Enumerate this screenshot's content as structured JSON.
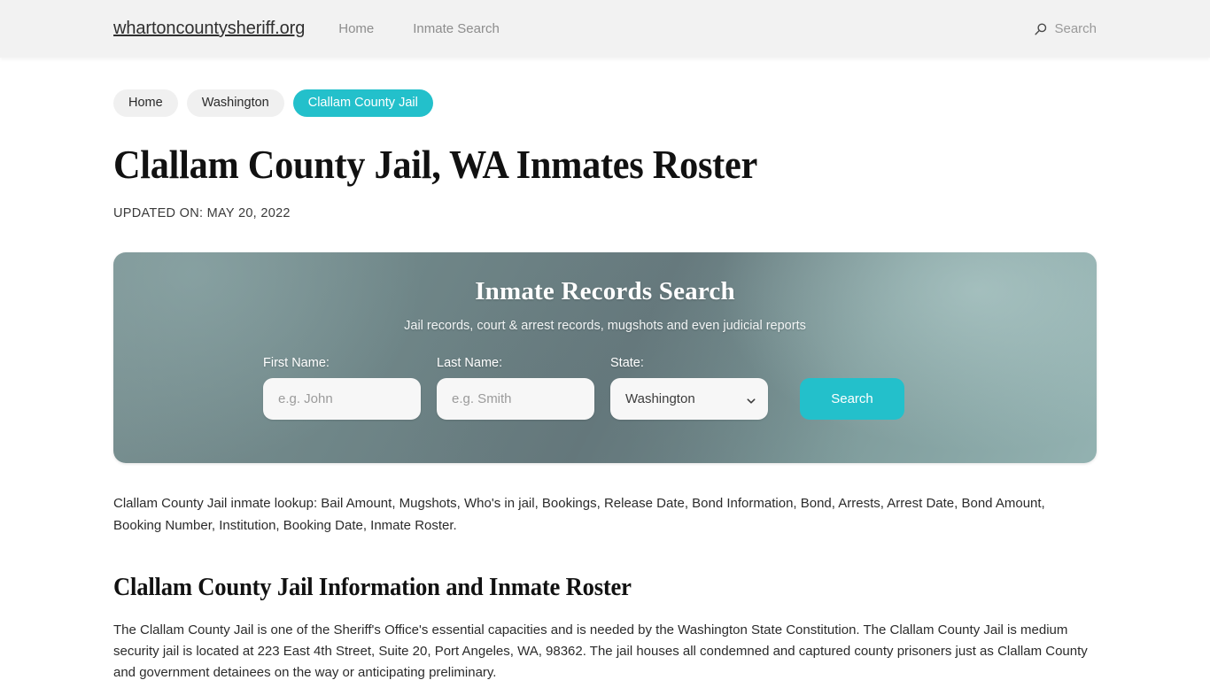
{
  "header": {
    "brand": "whartoncountysheriff.org",
    "nav": [
      {
        "label": "Home"
      },
      {
        "label": "Inmate Search"
      }
    ],
    "search": {
      "icon": "search-icon",
      "label": "Search"
    }
  },
  "breadcrumb": [
    {
      "label": "Home",
      "active": false
    },
    {
      "label": "Washington",
      "active": false
    },
    {
      "label": "Clallam County Jail",
      "active": true
    }
  ],
  "main": {
    "title": "Clallam County Jail, WA Inmates Roster",
    "updated": "UPDATED ON: MAY 20, 2022",
    "lookup_text": "Clallam County Jail inmate lookup: Bail Amount, Mugshots, Who's in jail, Bookings, Release Date, Bond Information, Bond, Arrests, Arrest Date, Bond Amount, Booking Number, Institution, Booking Date, Inmate Roster.",
    "section_title": "Clallam County Jail Information and Inmate Roster",
    "body_text": "The Clallam County Jail is one of the Sheriff's Office's essential capacities and is needed by the Washington State Constitution. The Clallam County Jail is medium security jail is located at 223 East 4th Street, Suite 20, Port Angeles, WA, 98362. The jail houses all condemned and captured county prisoners just as Clallam County and government detainees on the way or anticipating preliminary."
  },
  "hero": {
    "title": "Inmate Records Search",
    "subtitle": "Jail records, court & arrest records, mugshots and even judicial reports",
    "first_name": {
      "label": "First Name:",
      "placeholder": "e.g. John",
      "value": ""
    },
    "last_name": {
      "label": "Last Name:",
      "placeholder": "e.g. Smith",
      "value": ""
    },
    "state": {
      "label": "State:",
      "selected": "Washington",
      "caret_icon": "chevron-down-icon"
    },
    "search_button": "Search"
  },
  "colors": {
    "accent_teal": "#23c0cb",
    "header_bg": "#f2f2f2",
    "hero_slate": "#6f8688",
    "pill_bg": "#f0f0f0"
  }
}
